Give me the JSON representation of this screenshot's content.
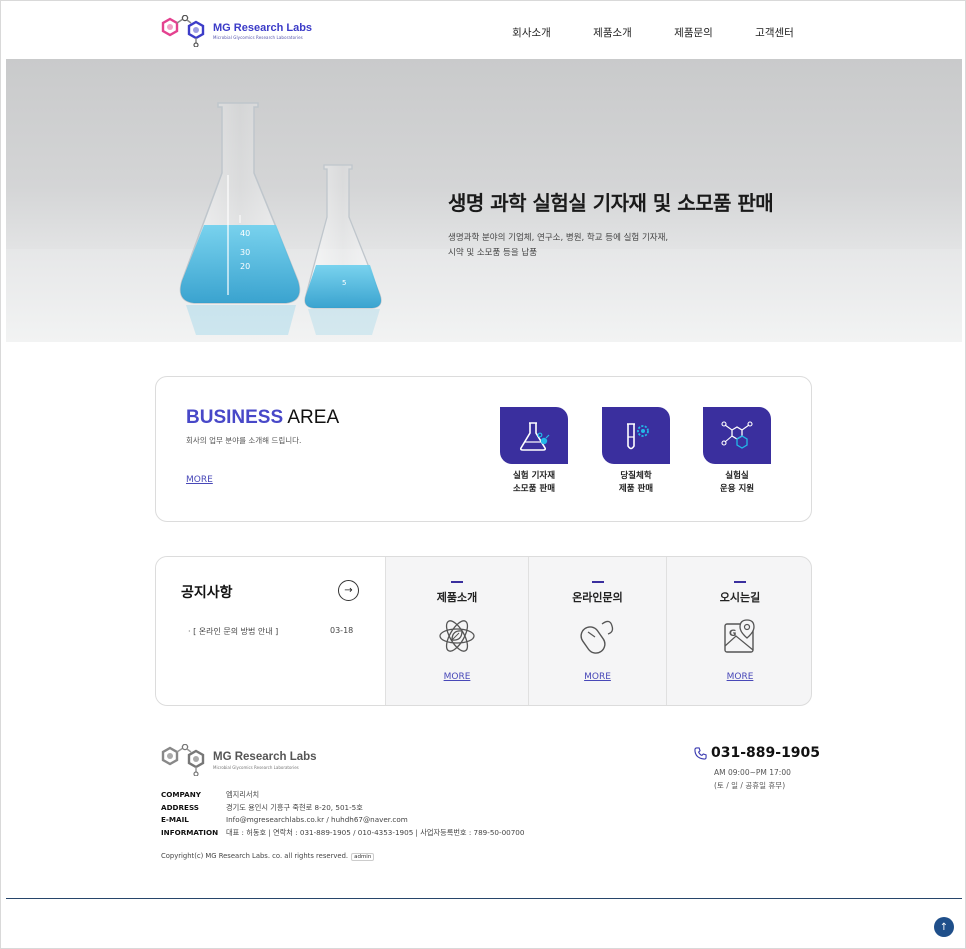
{
  "brand": {
    "name": "MG Research Labs",
    "tagline": "Microbial Glycomics Research Laboratories",
    "color": "#3c3cc8"
  },
  "nav": {
    "items": [
      "회사소개",
      "제품소개",
      "제품문의",
      "고객센터"
    ]
  },
  "hero": {
    "title": "생명 과학 실험실 기자재 및 소모품 판매",
    "desc_line1": "생명과학 분야의 기업체, 연구소, 병원, 학교 등에 실험 기자재,",
    "desc_line2": "시약 및 소모품 등을 납품"
  },
  "business": {
    "title_strong": "BUSINESS",
    "title_rest": " AREA",
    "desc": "회사의 업무 분야를 소개해 드립니다.",
    "more": "MORE",
    "items": [
      {
        "line1": "실험 기자재",
        "line2": "소모품 판매",
        "icon": "flask-icon"
      },
      {
        "line1": "당질체학",
        "line2": "제품 판매",
        "icon": "test-tube-gear-icon"
      },
      {
        "line1": "실험실",
        "line2": "운용 지원",
        "icon": "molecule-network-icon"
      }
    ],
    "accent": "#3a2f9e"
  },
  "notice": {
    "title": "공지사항",
    "arrow": "→",
    "item": "· [ 온라인 문의 방법 안내 ]",
    "date": "03-18"
  },
  "cards": [
    {
      "title": "제품소개",
      "more": "MORE",
      "icon": "atom-leaf-icon"
    },
    {
      "title": "온라인문의",
      "more": "MORE",
      "icon": "mouse-icon"
    },
    {
      "title": "오시는길",
      "more": "MORE",
      "icon": "map-pin-icon"
    }
  ],
  "footer": {
    "logo_title": "MG Research Labs",
    "logo_sub": "Microbial Glycomics Research Laboratories",
    "rows": [
      {
        "key": "COMPANY",
        "value": "엠지리서치"
      },
      {
        "key": "ADDRESS",
        "value": "경기도 용인시 기흥구 죽현로 8-20, 501-5호"
      },
      {
        "key": "E-MAIL",
        "value": "Info@mgresearchlabs.co.kr / huhdh67@naver.com"
      },
      {
        "key": "INFORMATION",
        "value": "대표 : 허동호  |  연락처 : 031-889-1905 / 010-4353-1905  |  사업자등록번호 : 789-50-00700"
      }
    ],
    "copyright": "Copyright(c) MG Research Labs. co. all rights reserved.",
    "admin": "admin",
    "phone": "031-889-1905",
    "hours1": "AM 09:00~PM 17:00",
    "hours2": "(토 / 일 / 공휴일 휴무)"
  },
  "to_top": "↑"
}
